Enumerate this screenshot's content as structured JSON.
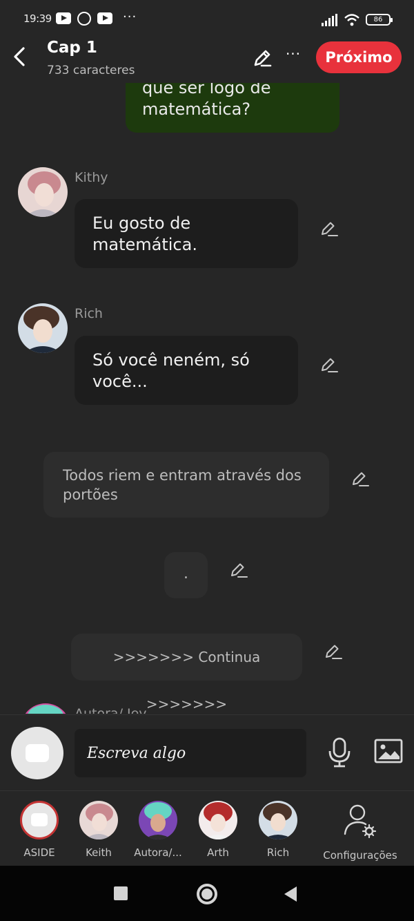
{
  "status_bar": {
    "time": "19:39",
    "battery": "86",
    "icons": [
      "youtube-icon",
      "whatsapp-icon",
      "youtube-icon",
      "more-dots-icon",
      "signal-icon",
      "wifi-icon",
      "battery-icon"
    ]
  },
  "header": {
    "title": "Cap 1",
    "subtitle": "733 caracteres",
    "next_label": "Próximo",
    "more_label": "···",
    "next_color": "#e8323c"
  },
  "chat": {
    "messages": [
      {
        "type": "own",
        "text": "que ser logo de matemática?",
        "bubble_color": "#1d3a0d"
      },
      {
        "type": "character",
        "speaker": "Kithy",
        "text": "Eu gosto de matemática."
      },
      {
        "type": "character",
        "speaker": "Rich",
        "text": "Só você neném, só você..."
      },
      {
        "type": "narration",
        "text": "Todos riem e entram através dos portões"
      },
      {
        "type": "narration",
        "text": "."
      },
      {
        "type": "narration",
        "text": ">>>>>>> Continua >>>>>>>"
      },
      {
        "type": "character",
        "speaker": "Autora/ Jey",
        "text": ""
      }
    ]
  },
  "composer": {
    "placeholder": "Escreva algo"
  },
  "characters": [
    {
      "label": "ASIDE"
    },
    {
      "label": "Keith"
    },
    {
      "label": "Autora/..."
    },
    {
      "label": "Arth"
    },
    {
      "label": "Rich"
    },
    {
      "label": "Configurações"
    }
  ]
}
